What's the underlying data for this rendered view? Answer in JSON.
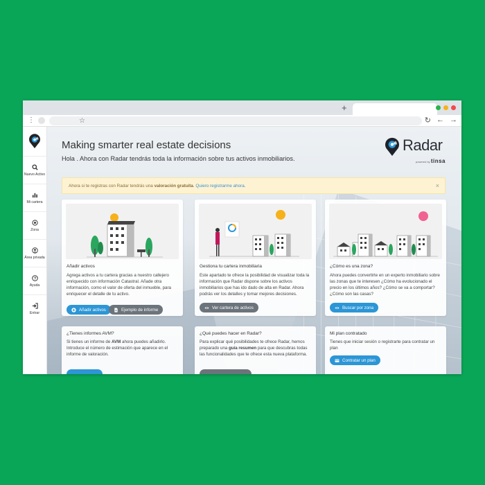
{
  "sidebar": {
    "items": [
      {
        "label": "Nuevo Activo",
        "icon": "search-icon"
      },
      {
        "label": "Mi cartera",
        "icon": "bar-chart-icon"
      },
      {
        "label": "Zona",
        "icon": "target-icon"
      },
      {
        "label": "Área privada",
        "icon": "user-icon"
      },
      {
        "label": "Ayuda",
        "icon": "help-icon"
      },
      {
        "label": "Entrar",
        "icon": "login-icon"
      }
    ]
  },
  "hero": {
    "title": "Making smarter real estate decisions",
    "subtitle": "Hola . Ahora con Radar tendrás toda la información sobre tus activos inmobiliarios."
  },
  "brand": {
    "name": "Radar",
    "powered_by": "powered by",
    "company": "tinsa"
  },
  "alert": {
    "text_start": "Ahora si te registras con Radar tendrás una ",
    "bold": "valoración gratuita",
    "text_mid": ". ",
    "link": "Quiero registrarme ahora",
    "text_end": ".",
    "close": "×"
  },
  "cards": [
    {
      "title": "Añadir activos",
      "body": "Agrega activos a tu cartera gracias a nuestro callejero enriquecido con información Catastral. Añade otra información, como el valor de oferta del inmueble, para enriquecer el detalle de tu activo.",
      "btn1": "Añadir activos",
      "btn2": "Ejemplo de informe"
    },
    {
      "title": "Gestiona tu cartera inmobiliaria",
      "body": "Este apartado te ofrece la posibilidad de visualizar toda la información que Radar dispone sobre los activos inmobiliarios que has ido dado de alta en Radar. Ahora podrás ver los detalles y tomar mejores decisiones.",
      "btn1": "Ver cartera de activos"
    },
    {
      "title": "¿Cómo es una zona?",
      "body": "Ahora puedes convertirte en un experto inmobiliario sobre las zonas que te interesen ¿Cómo ha evolucionado el precio en los últimos años? ¿Cómo se va a comportar? ¿Cómo son las casas?",
      "btn1": "Buscar por zona"
    },
    {
      "title": "¿Tienes informes AVM?",
      "body_start": "Si tienes un informe de ",
      "body_bold": "AVM",
      "body_end": " ahora puedes añadirlo. Introduce el número de estimación que aparece en el informe de valoración."
    },
    {
      "title": "¿Qué puedes hacer en Radar?",
      "body_start": "Para explicar qué posibilidades te ofrece Radar, hemos preparado una ",
      "body_bold": "guía resumen",
      "body_end": " para que descubras todas las funcionalidades que te ofrece esta nueva plataforma."
    },
    {
      "title": "Mi plan contratado",
      "body": "Tienes que iniciar sesión o registrarte para contratar un plan",
      "btn1": "Contratar un plan"
    }
  ],
  "colors": {
    "accent": "#2c96d6",
    "secondary": "#6c747b",
    "background": "#0aa657"
  }
}
